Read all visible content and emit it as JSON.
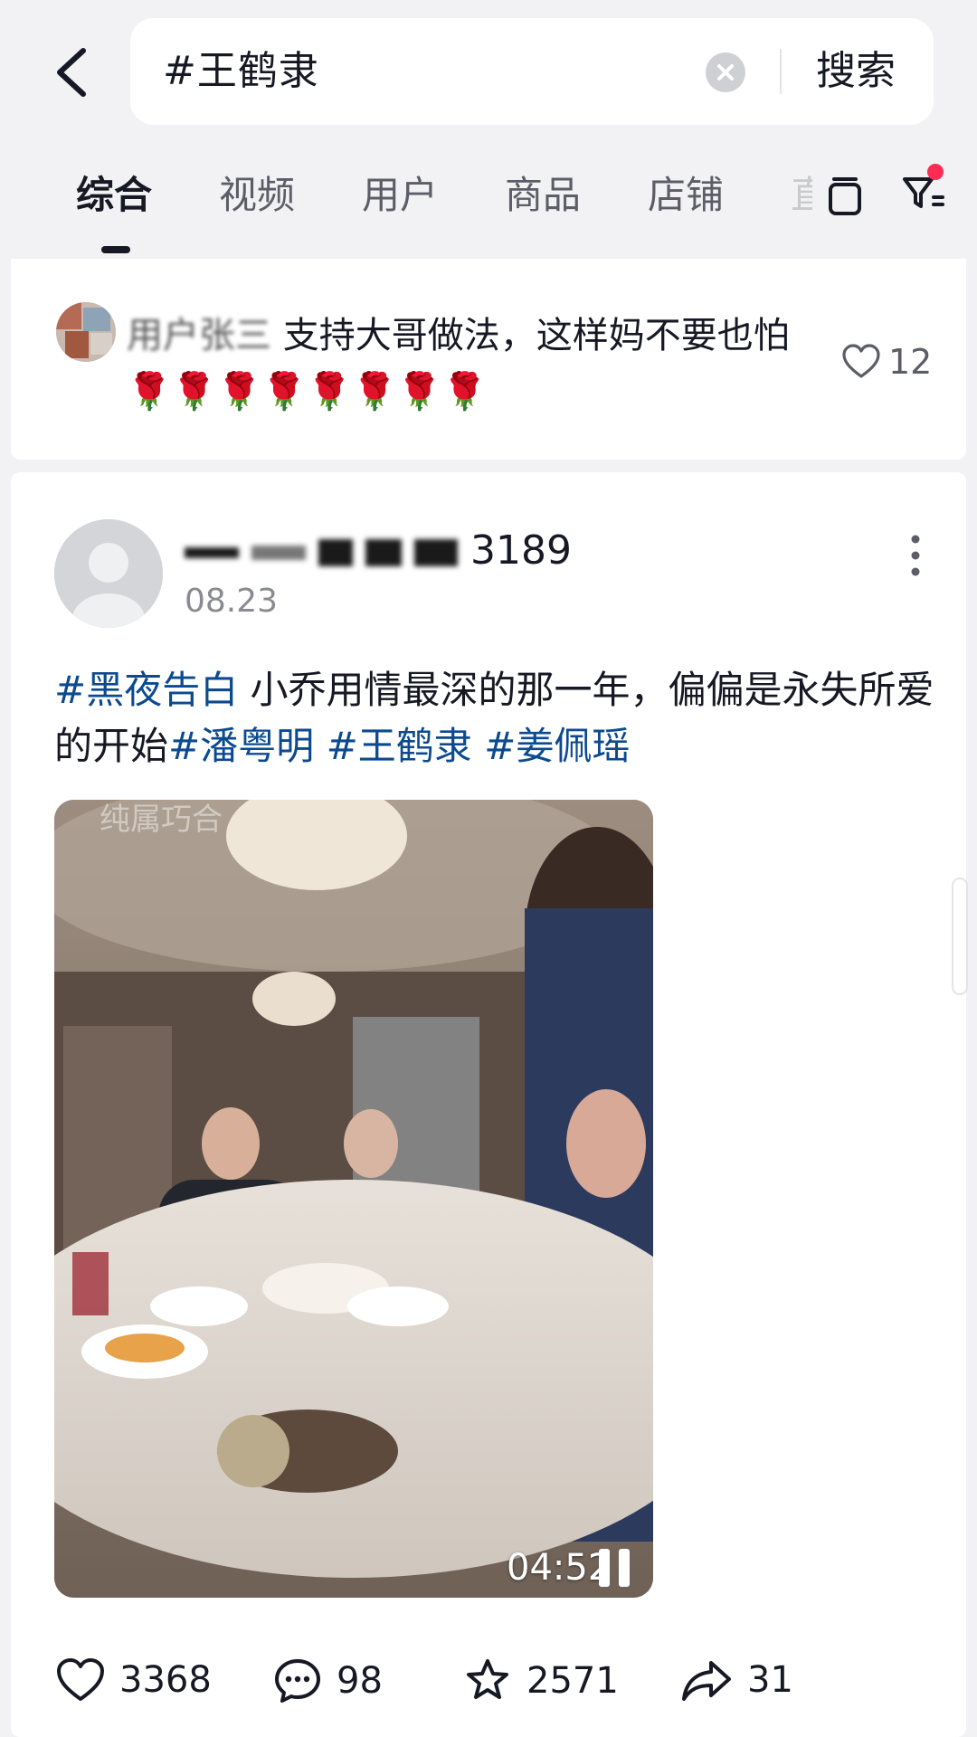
{
  "header": {
    "search_query": "#王鹤隶",
    "search_button": "搜索",
    "tabs": [
      {
        "label": "综合",
        "active": true
      },
      {
        "label": "视频"
      },
      {
        "label": "用户"
      },
      {
        "label": "商品"
      },
      {
        "label": "店铺"
      },
      {
        "label": "直"
      }
    ]
  },
  "comment": {
    "username": "用户张三",
    "text": " 支持大哥做法，这样妈不要也怕🌹🌹🌹🌹🌹🌹🌹🌹",
    "likes": "12"
  },
  "post": {
    "username_suffix": "3189",
    "date": "08.23",
    "text": {
      "tag1": "#黑夜告白",
      "body": " 小乔用情最深的那一年，偏偏是永失所爱的开始",
      "tag2": "#潘粤明",
      "tag3": "#王鹤隶",
      "tag4": "#姜佩瑶"
    },
    "video": {
      "watermark": "纯属巧合",
      "duration": "04:52"
    },
    "stats": {
      "likes": "3368",
      "comments": "98",
      "favorites": "2571",
      "shares": "31"
    }
  },
  "colors": {
    "hashtag": "#0b4a8f",
    "notification_dot": "#fe2c55",
    "background": "#f2f2f4"
  }
}
